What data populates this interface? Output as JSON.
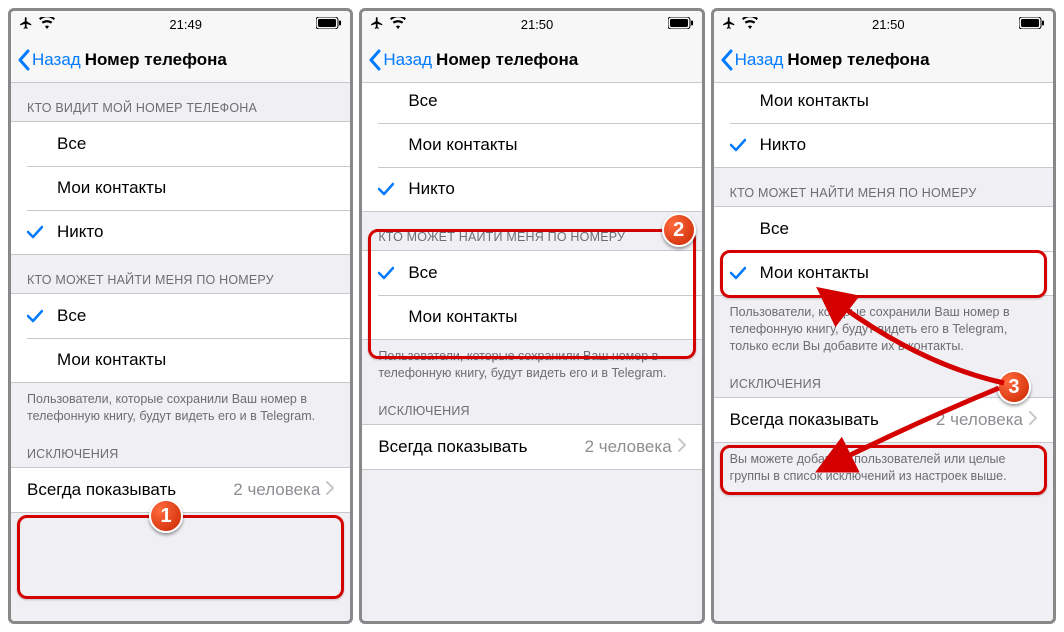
{
  "screens": [
    {
      "status": {
        "time": "21:49"
      },
      "nav": {
        "back": "Назад",
        "title": "Номер телефона"
      },
      "whoSees": {
        "header": "КТО ВИДИТ МОЙ НОМЕР ТЕЛЕФОНА",
        "options": [
          "Все",
          "Мои контакты",
          "Никто"
        ],
        "selected": 2
      },
      "whoFinds": {
        "header": "КТО МОЖЕТ НАЙТИ МЕНЯ ПО НОМЕРУ",
        "options": [
          "Все",
          "Мои контакты"
        ],
        "selected": 0,
        "footer": "Пользователи, которые сохранили Ваш номер в телефонную книгу, будут видеть его и в Telegram."
      },
      "exceptions": {
        "header": "ИСКЛЮЧЕНИЯ",
        "label": "Всегда показывать",
        "detail": "2 человека"
      }
    },
    {
      "status": {
        "time": "21:50"
      },
      "nav": {
        "back": "Назад",
        "title": "Номер телефона"
      },
      "whoSees": {
        "options": [
          "Все",
          "Мои контакты",
          "Никто"
        ],
        "selected": 2
      },
      "whoFinds": {
        "header": "КТО МОЖЕТ НАЙТИ МЕНЯ ПО НОМЕРУ",
        "options": [
          "Все",
          "Мои контакты"
        ],
        "selected": 0,
        "footer": "Пользователи, которые сохранили Ваш номер в телефонную книгу, будут видеть его и в Telegram."
      },
      "exceptions": {
        "header": "ИСКЛЮЧЕНИЯ",
        "label": "Всегда показывать",
        "detail": "2 человека"
      }
    },
    {
      "status": {
        "time": "21:50"
      },
      "nav": {
        "back": "Назад",
        "title": "Номер телефона"
      },
      "whoSeesPartial": {
        "options": [
          "Мои контакты",
          "Никто"
        ],
        "selected": 1
      },
      "whoFinds": {
        "header": "КТО МОЖЕТ НАЙТИ МЕНЯ ПО НОМЕРУ",
        "options": [
          "Все",
          "Мои контакты"
        ],
        "selected": 1,
        "footer": "Пользователи, которые сохранили Ваш номер в телефонную книгу, будут видеть его в Telegram, только если Вы добавите их в контакты."
      },
      "exceptions": {
        "header": "ИСКЛЮЧЕНИЯ",
        "label": "Всегда показывать",
        "detail": "2 человека",
        "footer": "Вы можете добавить пользователей или целые группы в список исключений из настроек выше."
      }
    }
  ]
}
